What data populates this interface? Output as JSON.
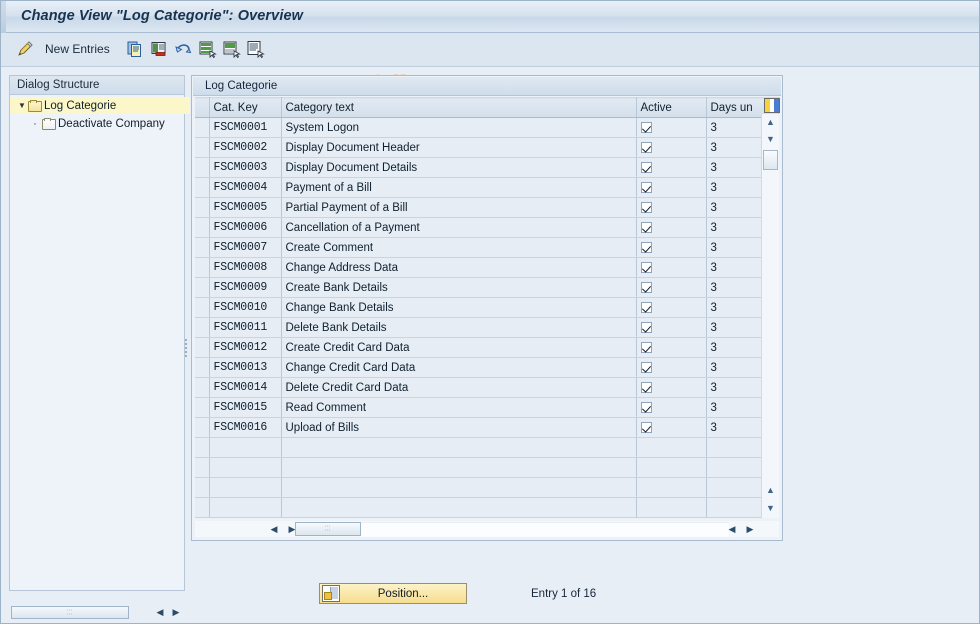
{
  "window": {
    "title": "Change View \"Log Categorie\": Overview"
  },
  "toolbar": {
    "pencil_icon": "pencil-edit-icon",
    "new_entries_label": "New Entries",
    "icons": [
      {
        "name": "copy-icon",
        "title": "Copy As..."
      },
      {
        "name": "delete-icon",
        "title": "Delete"
      },
      {
        "name": "undo-icon",
        "title": "Undo Change"
      },
      {
        "name": "select-all-icon",
        "title": "Select All"
      },
      {
        "name": "deselect-all-icon",
        "title": "Deselect All"
      },
      {
        "name": "variant-icon",
        "title": "Select Layout"
      }
    ]
  },
  "watermark": {
    "text": "www.tutorialkart.com"
  },
  "sidebar": {
    "header": "Dialog Structure",
    "items": [
      {
        "label": "Log Categorie",
        "level": 0,
        "expanded": true,
        "selected": true,
        "twisty": "▼"
      },
      {
        "label": "Deactivate Company",
        "level": 1,
        "expanded": false,
        "selected": false,
        "bullet": "·"
      }
    ]
  },
  "table": {
    "caption": "Log Categorie",
    "columns": [
      {
        "key": "selector",
        "label": ""
      },
      {
        "key": "cat_key",
        "label": "Cat. Key"
      },
      {
        "key": "category_text",
        "label": "Category text"
      },
      {
        "key": "active",
        "label": "Active"
      },
      {
        "key": "days_until",
        "label": "Days un"
      }
    ],
    "column_config_icon": "column-settings-icon",
    "rows": [
      {
        "cat_key": "FSCM0001",
        "category_text": "System Logon",
        "active": true,
        "days": "3"
      },
      {
        "cat_key": "FSCM0002",
        "category_text": "Display Document Header",
        "active": true,
        "days": "3"
      },
      {
        "cat_key": "FSCM0003",
        "category_text": "Display Document Details",
        "active": true,
        "days": "3"
      },
      {
        "cat_key": "FSCM0004",
        "category_text": "Payment of a Bill",
        "active": true,
        "days": "3"
      },
      {
        "cat_key": "FSCM0005",
        "category_text": "Partial Payment of a Bill",
        "active": true,
        "days": "3"
      },
      {
        "cat_key": "FSCM0006",
        "category_text": "Cancellation of a Payment",
        "active": true,
        "days": "3"
      },
      {
        "cat_key": "FSCM0007",
        "category_text": "Create Comment",
        "active": true,
        "days": "3"
      },
      {
        "cat_key": "FSCM0008",
        "category_text": "Change Address Data",
        "active": true,
        "days": "3"
      },
      {
        "cat_key": "FSCM0009",
        "category_text": "Create Bank Details",
        "active": true,
        "days": "3"
      },
      {
        "cat_key": "FSCM0010",
        "category_text": "Change Bank Details",
        "active": true,
        "days": "3"
      },
      {
        "cat_key": "FSCM0011",
        "category_text": "Delete Bank Details",
        "active": true,
        "days": "3"
      },
      {
        "cat_key": "FSCM0012",
        "category_text": "Create Credit Card Data",
        "active": true,
        "days": "3"
      },
      {
        "cat_key": "FSCM0013",
        "category_text": "Change Credit Card Data",
        "active": true,
        "days": "3"
      },
      {
        "cat_key": "FSCM0014",
        "category_text": "Delete Credit Card Data",
        "active": true,
        "days": "3"
      },
      {
        "cat_key": "FSCM0015",
        "category_text": "Read Comment",
        "active": true,
        "days": "3"
      },
      {
        "cat_key": "FSCM0016",
        "category_text": "Upload of Bills",
        "active": true,
        "days": "3"
      }
    ],
    "empty_rows": 4
  },
  "scrollbars": {
    "up_arrow": "▲",
    "down_arrow": "▼",
    "left_arrow": "◀",
    "right_arrow": "▶",
    "grip": "⋯"
  },
  "footer": {
    "position_button_label": "Position...",
    "entry_status": "Entry 1 of 16"
  },
  "colors": {
    "title_text": "#18334f",
    "toolbar_bg": "#dce6f0",
    "selected_tree_row": "#fbf7c8",
    "watermark": "#e8b98e",
    "button_yellow": "#f6dd8e",
    "row_bg": "#e6edf5"
  }
}
